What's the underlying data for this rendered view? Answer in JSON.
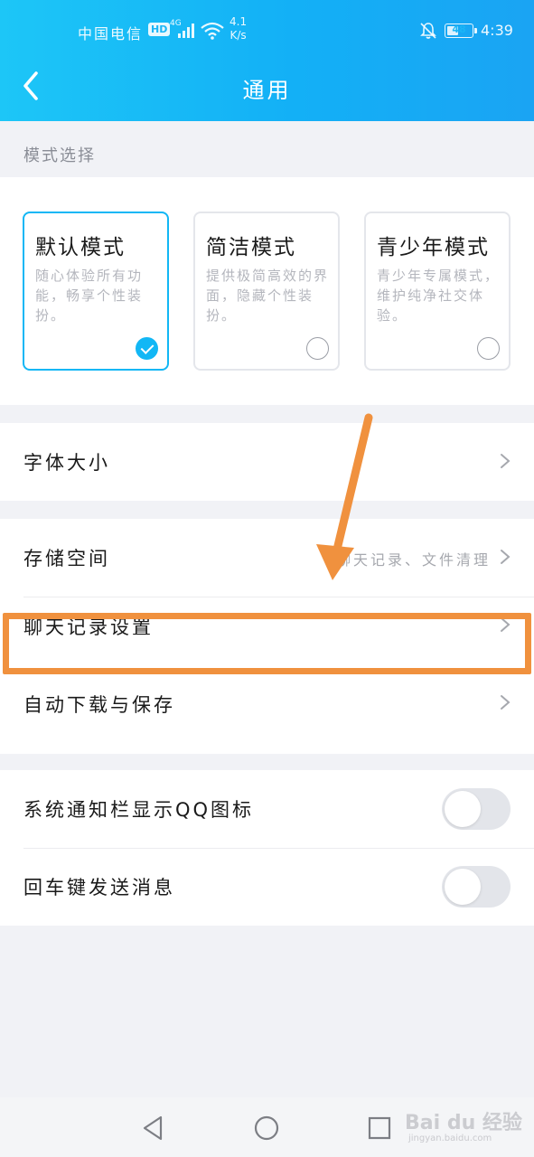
{
  "status_bar": {
    "carrier": "中国电信",
    "hd": "HD",
    "network": "4G",
    "speed_value": "4.1",
    "speed_unit": "K/s",
    "battery": "48",
    "time": "4:39"
  },
  "nav": {
    "title": "通用"
  },
  "mode_section": {
    "label": "模式选择",
    "cards": [
      {
        "title": "默认模式",
        "desc": "随心体验所有功能，畅享个性装扮。",
        "selected": true
      },
      {
        "title": "简洁模式",
        "desc": "提供极简高效的界面，隐藏个性装扮。",
        "selected": false
      },
      {
        "title": "青少年模式",
        "desc": "青少年专属模式，维护纯净社交体验。",
        "selected": false
      }
    ]
  },
  "rows": {
    "font_size": "字体大小",
    "storage": "存储空间",
    "storage_value": "聊天记录、文件清理",
    "chat_record": "聊天记录设置",
    "auto_download": "自动下载与保存",
    "notify_icon": "系统通知栏显示QQ图标",
    "enter_send": "回车键发送消息"
  },
  "toggles": {
    "notify_icon_on": false,
    "enter_send_on": false
  },
  "watermark": {
    "brand": "Bai du 经验",
    "sub": "jingyan.baidu.com"
  },
  "colors": {
    "header_gradient_start": "#1dc6f7",
    "header_gradient_end": "#1aa4f3",
    "accent": "#12b7f5",
    "annotation": "#f0913e"
  }
}
